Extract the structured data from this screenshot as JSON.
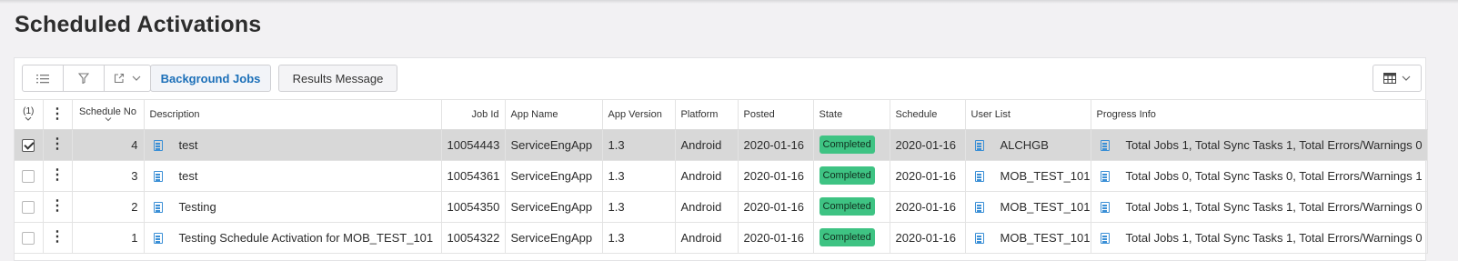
{
  "page": {
    "title": "Scheduled Activations"
  },
  "toolbar": {
    "background_jobs_label": "Background Jobs",
    "results_message_label": "Results Message"
  },
  "table": {
    "selection_count": "(1)",
    "columns": {
      "schedule_no": "Schedule No",
      "description": "Description",
      "job_id": "Job Id",
      "app_name": "App Name",
      "app_version": "App Version",
      "platform": "Platform",
      "posted": "Posted",
      "state": "State",
      "schedule": "Schedule",
      "user_list": "User List",
      "progress_info": "Progress Info"
    },
    "rows": [
      {
        "selected": true,
        "schedule_no": "4",
        "description": "test",
        "job_id": "10054443",
        "app_name": "ServiceEngApp",
        "app_version": "1.3",
        "platform": "Android",
        "posted": "2020-01-16",
        "state": "Completed",
        "schedule": "2020-01-16",
        "user_list": "ALCHGB",
        "progress_info": "Total Jobs 1, Total Sync Tasks 1, Total Errors/Warnings 0"
      },
      {
        "selected": false,
        "schedule_no": "3",
        "description": "test",
        "job_id": "10054361",
        "app_name": "ServiceEngApp",
        "app_version": "1.3",
        "platform": "Android",
        "posted": "2020-01-16",
        "state": "Completed",
        "schedule": "2020-01-16",
        "user_list": "MOB_TEST_101",
        "progress_info": "Total Jobs 0, Total Sync Tasks 0, Total Errors/Warnings 1"
      },
      {
        "selected": false,
        "schedule_no": "2",
        "description": "Testing",
        "job_id": "10054350",
        "app_name": "ServiceEngApp",
        "app_version": "1.3",
        "platform": "Android",
        "posted": "2020-01-16",
        "state": "Completed",
        "schedule": "2020-01-16",
        "user_list": "MOB_TEST_101",
        "progress_info": "Total Jobs 1, Total Sync Tasks 1, Total Errors/Warnings 0"
      },
      {
        "selected": false,
        "schedule_no": "1",
        "description": "Testing Schedule Activation for MOB_TEST_101",
        "job_id": "10054322",
        "app_name": "ServiceEngApp",
        "app_version": "1.3",
        "platform": "Android",
        "posted": "2020-01-16",
        "state": "Completed",
        "schedule": "2020-01-16",
        "user_list": "MOB_TEST_101",
        "progress_info": "Total Jobs 1, Total Sync Tasks 1, Total Errors/Warnings 0"
      }
    ]
  },
  "colors": {
    "accent": "#1b6fb8",
    "completed_badge": "#3ec383",
    "icon_blue": "#3a8fd6",
    "selected_row": "#d8d8d8"
  },
  "icons": {
    "list_toggle": "list-icon",
    "filter": "filter-icon",
    "export": "export-icon",
    "column_chooser": "table-grid-icon",
    "row_doc": "document-icon",
    "row_menu": "kebab-icon"
  }
}
